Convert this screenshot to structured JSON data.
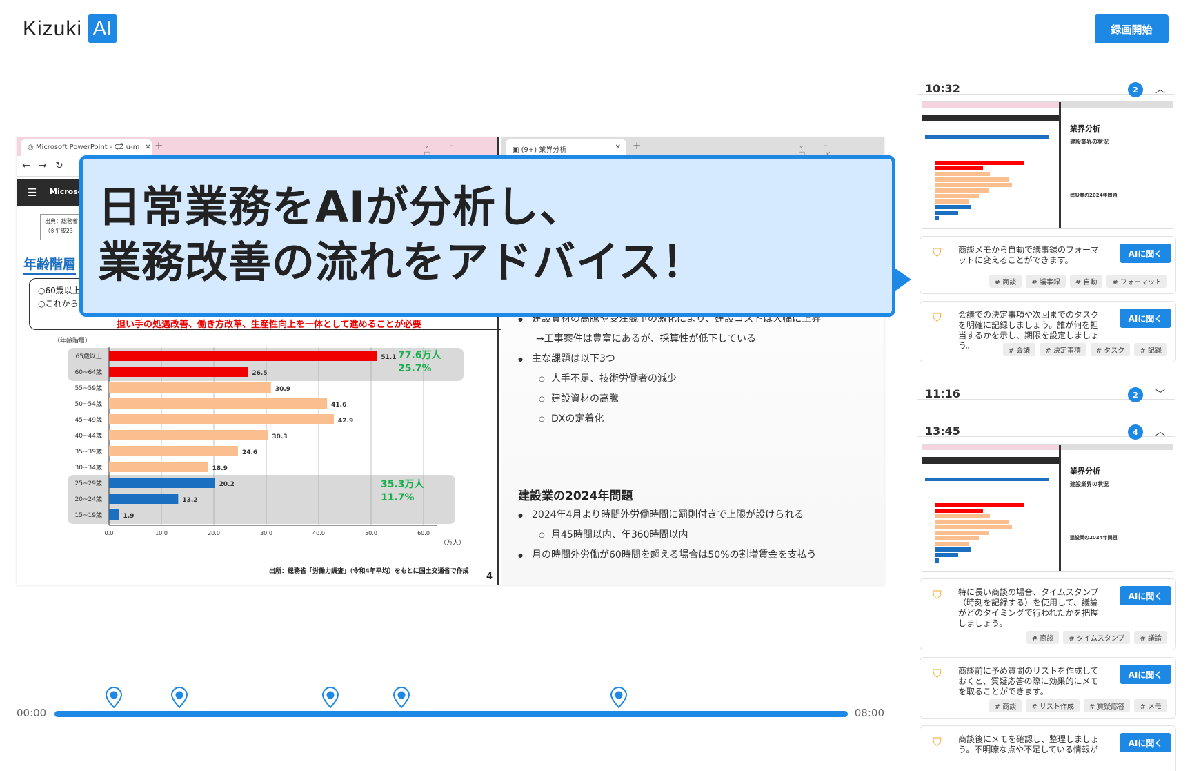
{
  "header": {
    "logo_text": "Kizuki",
    "logo_badge": "AI",
    "record_button": "録画開始"
  },
  "stage": {
    "left_window": {
      "tab_title": "Microsoft PowerPoint - ÇŽ ú-m",
      "ppt_title": "Microsoft",
      "source_line1": "出典：総務省",
      "source_line2": "（※平成23",
      "slide_title": "年齢階層",
      "bullet1": "○60歳以上の",
      "bullet2": "○これからの",
      "red_note": "担い手の処遇改善、働き方改革、生産性向上を一体として進めることが必要",
      "chart_source": "出所：総務省「労働力調査」（令和4年平均）をもとに国土交通省で作成",
      "page_number": "4"
    },
    "right_window": {
      "tab_title": "(9+) 業界分析",
      "bullets_top": [
        {
          "text": "建設資材の高騰や受注競争の激化により、建設コストは大幅に上昇",
          "type": "main"
        },
        {
          "text": "→工事案件は豊富にあるが、採算性が低下している",
          "type": "arrow"
        },
        {
          "text": "主な課題は以下3つ",
          "type": "main"
        },
        {
          "text": "人手不足、技術労働者の減少",
          "type": "sub"
        },
        {
          "text": "建設資材の高騰",
          "type": "sub"
        },
        {
          "text": "DXの定着化",
          "type": "sub"
        }
      ],
      "heading": "建設業の2024年問題",
      "bullets_bottom": [
        {
          "text": "2024年4月より時間外労働時間に罰則付きで上限が設けられる",
          "type": "main"
        },
        {
          "text": "月45時間以内、年360時間以内",
          "type": "sub"
        },
        {
          "text": "月の時間外労働が60時間を超える場合は50%の割増賃金を支払う",
          "type": "main"
        }
      ]
    },
    "callout": {
      "line1": "日常業務をAIが分析し、",
      "line2": "業務改善の流れをアドバイス！"
    }
  },
  "timeline": {
    "start": "00:00",
    "end": "08:00",
    "pins": [
      0.075,
      0.157,
      0.348,
      0.437,
      0.711
    ]
  },
  "chart_data": {
    "type": "bar",
    "orientation": "horizontal",
    "title": "",
    "ylabel": "（年齢階層）",
    "xlabel": "（万人）",
    "xlim": [
      0,
      60
    ],
    "xticks": [
      "0.0",
      "10.0",
      "20.0",
      "30.0",
      "40.0",
      "50.0",
      "60.0"
    ],
    "categories": [
      "65歳以上",
      "60~64歳",
      "55~59歳",
      "50~54歳",
      "45~49歳",
      "40~44歳",
      "35~39歳",
      "30~34歳",
      "25~29歳",
      "20~24歳",
      "15~19歳"
    ],
    "values": [
      51.1,
      26.5,
      30.9,
      41.6,
      42.9,
      30.3,
      24.6,
      18.9,
      20.2,
      13.2,
      1.9
    ],
    "value_labels": [
      "51.1",
      "26.5",
      "30.9",
      "41.6",
      "42.9",
      "30.3",
      "24.6",
      "18.9",
      "20.2",
      "13.2",
      "1.9"
    ],
    "colors": [
      "#f00000",
      "#f00000",
      "#fbbf8f",
      "#fbbf8f",
      "#fbbf8f",
      "#fbbf8f",
      "#fbbf8f",
      "#fbbf8f",
      "#1b6fc1",
      "#1b6fc1",
      "#1b6fc1"
    ],
    "annotations": [
      {
        "line1": "77.6万人",
        "line2": "25.7%",
        "group": "older"
      },
      {
        "line1": "35.3万人",
        "line2": "11.7%",
        "group": "younger"
      }
    ],
    "annotation_color": "#1aae4d",
    "grid": true
  },
  "sidebar": {
    "sections": [
      {
        "time": "10:32",
        "count": "2",
        "chevron": "chevron-up",
        "thumb": {
          "title": "業界分析",
          "sub1": "建設業界の状況",
          "sub2": "建設業の2024年問題"
        },
        "notes": [
          {
            "text": "商談メモから自動で議事録のフォーマットに変えることができます。",
            "button": "AIに聞く",
            "tags": [
              "# 商談",
              "# 議事録",
              "# 自動",
              "# フォーマット"
            ]
          },
          {
            "text": "会議での決定事項や次回までのタスクを明確に記録しましょう。誰が何を担当するかを示し、期限を設定しましょう。",
            "button": "AIに聞く",
            "tags": [
              "# 会議",
              "# 決定事項",
              "# タスク",
              "# 記録"
            ]
          }
        ]
      },
      {
        "time": "11:16",
        "count": "2",
        "chevron": "chevron-down"
      },
      {
        "time": "13:45",
        "count": "4",
        "chevron": "chevron-up",
        "thumb": {
          "title": "業界分析",
          "sub1": "建設業界の状況",
          "sub2": "建設業の2024年問題"
        },
        "notes": [
          {
            "text": "特に長い商談の場合、タイムスタンプ（時刻を記録する）を使用して、議論がどのタイミングで行われたかを把握しましょう。",
            "button": "AIに聞く",
            "tags": [
              "# 商談",
              "# タイムスタンプ",
              "# 議論"
            ]
          },
          {
            "text": "商談前に予め質問のリストを作成しておくと、質疑応答の際に効果的にメモを取ることができます。",
            "button": "AIに聞く",
            "tags": [
              "# 商談",
              "# リスト作成",
              "# 質疑応答",
              "# メモ"
            ]
          },
          {
            "text": "商談後にメモを確認し、整理しましょう。不明瞭な点や不足している情報が",
            "button": "AIに聞く",
            "tags": []
          }
        ]
      }
    ]
  },
  "colors": {
    "accent": "#1e88e5",
    "bookmark": "#f5a623",
    "callout_bg": "#d6eaff"
  }
}
